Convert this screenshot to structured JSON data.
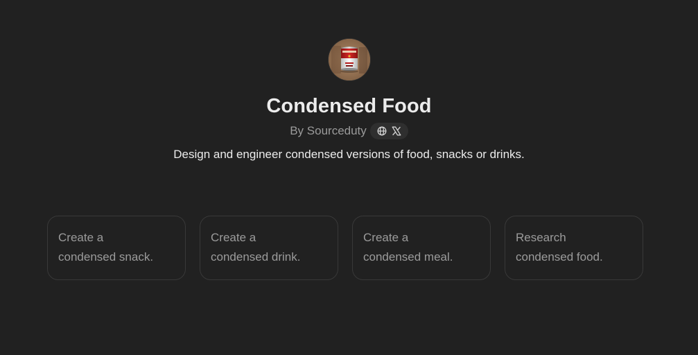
{
  "gpt": {
    "name": "Condensed Food",
    "author": "By Sourceduty",
    "description": "Design and engineer condensed versions of food, snacks or drinks.",
    "avatar_icon": "soup-can-icon",
    "social_links": [
      {
        "icon": "globe-icon"
      },
      {
        "icon": "x-logo-icon"
      }
    ]
  },
  "conversation_starters": [
    {
      "text": "Create a\ncondensed snack."
    },
    {
      "text": "Create a\ncondensed drink."
    },
    {
      "text": "Create a\ncondensed meal."
    },
    {
      "text": "Research\ncondensed food."
    }
  ],
  "colors": {
    "background": "#212121",
    "title": "#ececec",
    "muted_text": "#9b9b9b",
    "card_border": "#393939",
    "pill_background": "#2f2f2f"
  }
}
